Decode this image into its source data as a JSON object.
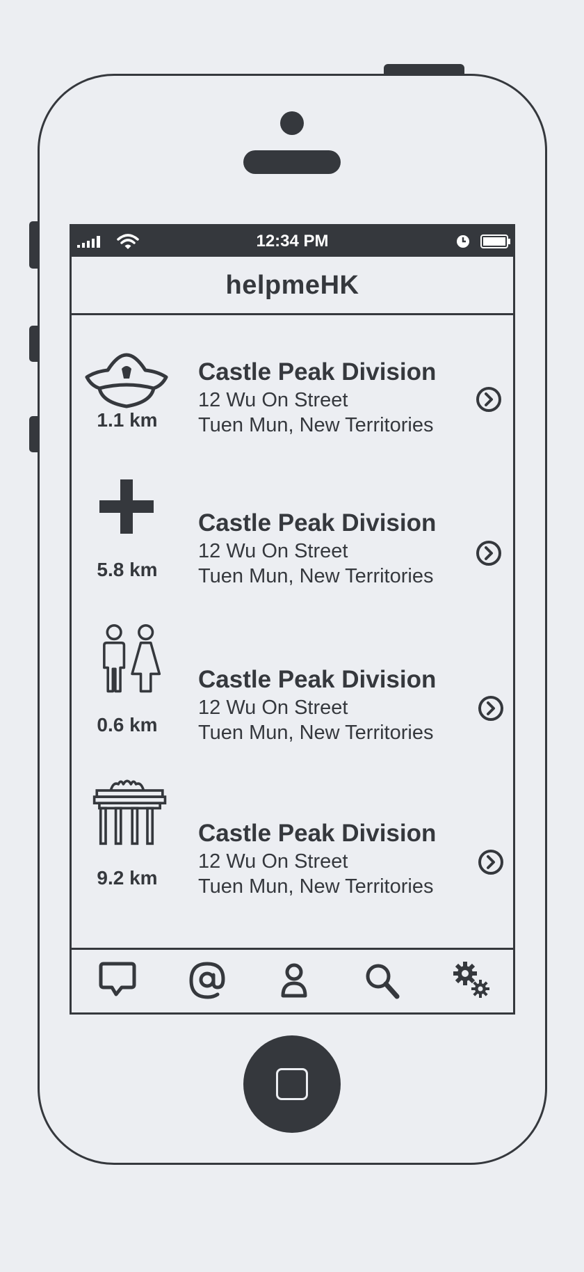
{
  "status_bar": {
    "time": "12:34 PM",
    "signal_icon": "signal-bars-icon",
    "wifi_icon": "wifi-icon",
    "alarm_icon": "clock-icon",
    "battery_icon": "battery-icon"
  },
  "nav_bar": {
    "title": "helpmeHK"
  },
  "list": {
    "items": [
      {
        "icon": "police-cap-icon",
        "distance": "1.1 km",
        "name": "Castle Peak Division",
        "address_line1": "12 Wu On Street",
        "address_line2": "Tuen Mun, New Territories"
      },
      {
        "icon": "medical-cross-icon",
        "distance": "5.8 km",
        "name": "Castle Peak Division",
        "address_line1": "12 Wu On Street",
        "address_line2": "Tuen Mun, New Territories"
      },
      {
        "icon": "restroom-icon",
        "distance": "0.6 km",
        "name": "Castle Peak Division",
        "address_line1": "12 Wu On Street",
        "address_line2": "Tuen Mun, New Territories"
      },
      {
        "icon": "gate-landmark-icon",
        "distance": "9.2 km",
        "name": "Castle Peak Division",
        "address_line1": "12 Wu On Street",
        "address_line2": "Tuen Mun, New Territories"
      }
    ]
  },
  "tab_bar": {
    "tabs": [
      "chat-bubble-icon",
      "at-sign-icon",
      "person-icon",
      "search-icon",
      "gears-icon"
    ]
  },
  "colors": {
    "ink": "#35383d",
    "background": "#eceef2",
    "status_text": "#ffffff"
  }
}
